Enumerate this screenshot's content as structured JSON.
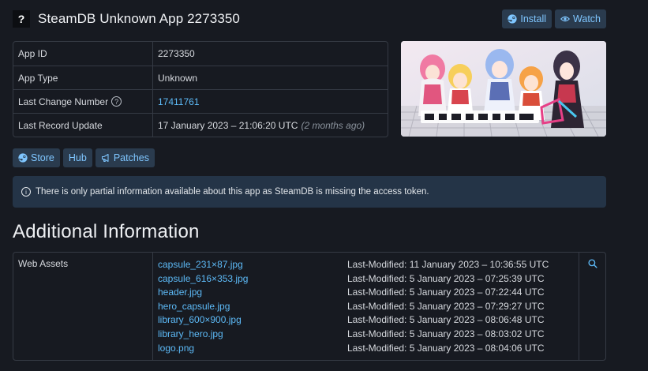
{
  "header": {
    "icon_glyph": "?",
    "title": "SteamDB Unknown App 2273350",
    "install_label": "Install",
    "watch_label": "Watch"
  },
  "info": {
    "rows": [
      {
        "label": "App ID",
        "value": "2273350"
      },
      {
        "label": "App Type",
        "value": "Unknown"
      },
      {
        "label": "Last Change Number",
        "value": "17411761"
      },
      {
        "label": "Last Record Update",
        "value": "17 January 2023 – 21:06:20 UTC",
        "note": "(2 months ago)"
      }
    ]
  },
  "sub_actions": {
    "store_label": "Store",
    "hub_label": "Hub",
    "patches_label": "Patches"
  },
  "notice": {
    "text": "There is only partial information available about this app as SteamDB is missing the access token."
  },
  "section": {
    "heading": "Additional Information"
  },
  "assets": {
    "label": "Web Assets",
    "files": [
      {
        "name": "capsule_231×87.jpg",
        "modified": "Last-Modified: 11 January 2023 – 10:36:55 UTC"
      },
      {
        "name": "capsule_616×353.jpg",
        "modified": "Last-Modified: 5 January 2023 – 07:25:39 UTC"
      },
      {
        "name": "header.jpg",
        "modified": "Last-Modified: 5 January 2023 – 07:22:44 UTC"
      },
      {
        "name": "hero_capsule.jpg",
        "modified": "Last-Modified: 5 January 2023 – 07:29:27 UTC"
      },
      {
        "name": "library_600×900.jpg",
        "modified": "Last-Modified: 5 January 2023 – 08:06:48 UTC"
      },
      {
        "name": "library_hero.jpg",
        "modified": "Last-Modified: 5 January 2023 – 08:03:02 UTC"
      },
      {
        "name": "logo.png",
        "modified": "Last-Modified: 5 January 2023 – 08:04:06 UTC"
      }
    ]
  },
  "colors": {
    "background": "#171a21",
    "accent": "#5dbaf7",
    "button_bg": "#2a3b4e",
    "notice_bg": "#243447",
    "border": "#353a44"
  },
  "icons": {
    "install": "steam-icon",
    "watch": "eye-icon",
    "store": "steam-icon",
    "patches": "megaphone-icon",
    "notice": "info-icon",
    "search": "search-icon",
    "help": "question-circle-icon"
  }
}
